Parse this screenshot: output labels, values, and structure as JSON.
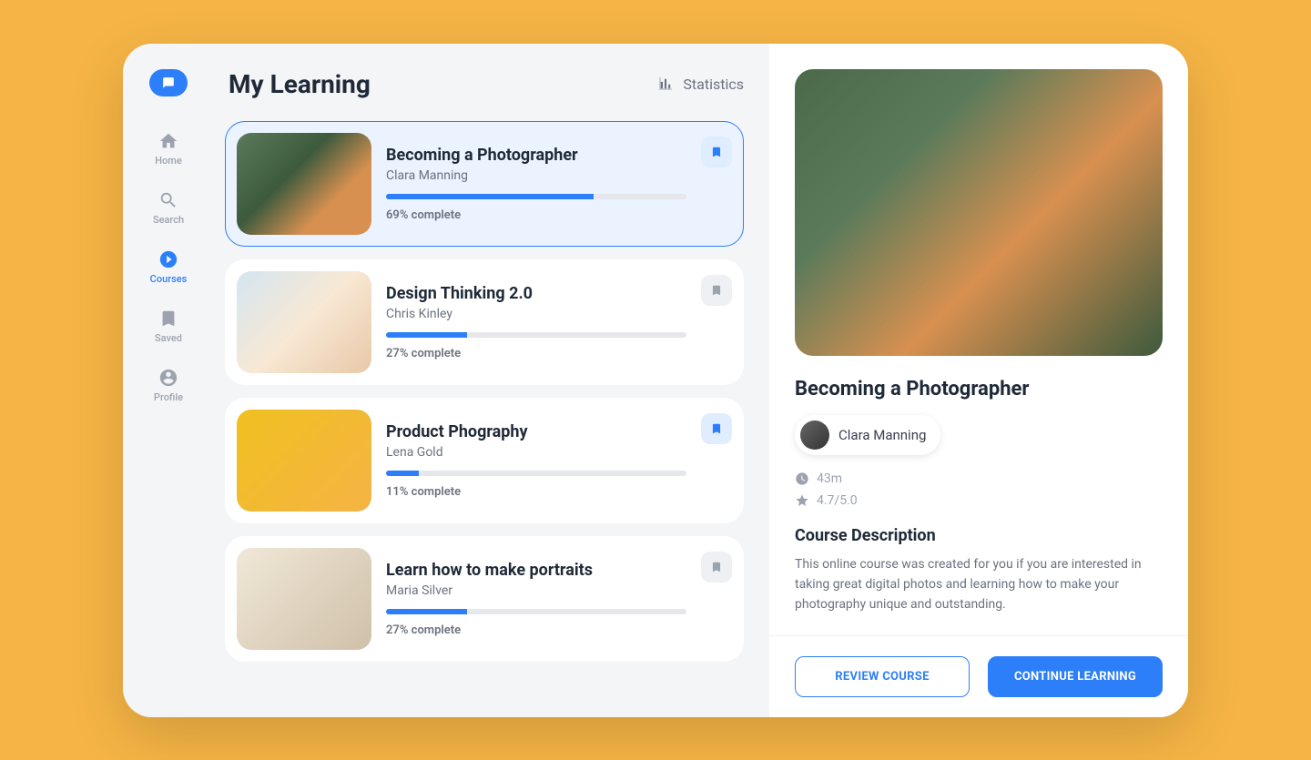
{
  "sidebar": {
    "items": [
      {
        "label": "Home"
      },
      {
        "label": "Search"
      },
      {
        "label": "Courses"
      },
      {
        "label": "Saved"
      },
      {
        "label": "Profile"
      }
    ]
  },
  "header": {
    "title": "My Learning",
    "statistics_label": "Statistics"
  },
  "courses": [
    {
      "title": "Becoming a Photographer",
      "author": "Clara Manning",
      "progress": 69,
      "progress_text": "69% complete",
      "saved": true
    },
    {
      "title": "Design Thinking 2.0",
      "author": "Chris Kinley",
      "progress": 27,
      "progress_text": "27% complete",
      "saved": false
    },
    {
      "title": "Product Phography",
      "author": "Lena Gold",
      "progress": 11,
      "progress_text": "11% complete",
      "saved": true
    },
    {
      "title": "Learn how to make portraits",
      "author": "Maria Silver",
      "progress": 27,
      "progress_text": "27% complete",
      "saved": false
    }
  ],
  "detail": {
    "title": "Becoming a Photographer",
    "author": "Clara Manning",
    "duration": "43m",
    "rating": "4.7/5.0",
    "description_heading": "Course Description",
    "description": "This online course was created for you if you are interested in taking great digital photos and learning how to make your photography unique and outstanding."
  },
  "actions": {
    "review": "REVIEW COURSE",
    "continue": "CONTINUE LEARNING"
  }
}
